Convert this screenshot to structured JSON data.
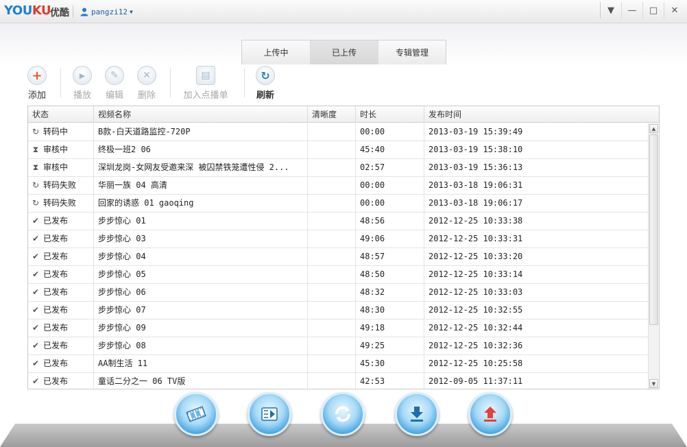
{
  "titlebar": {
    "logo_you": "YOU",
    "logo_ku": "KU",
    "logo_cn": "优酷",
    "username": "pangzi12",
    "caret": "▼",
    "win_buttons": [
      "▼",
      "—",
      "□",
      "✕"
    ]
  },
  "tabs": [
    {
      "label": "上传中",
      "active": false
    },
    {
      "label": "已上传",
      "active": true
    },
    {
      "label": "专辑管理",
      "active": false
    }
  ],
  "toolbar": {
    "add": {
      "label": "添加",
      "icon": "plus-icon",
      "glyph": "+",
      "color": "#e8572d"
    },
    "play": {
      "label": "播放",
      "icon": "play-icon",
      "glyph": "▶"
    },
    "edit": {
      "label": "编辑",
      "icon": "pencil-icon",
      "glyph": "✎"
    },
    "delete": {
      "label": "删除",
      "icon": "cross-icon",
      "glyph": "✕"
    },
    "add_playlist": {
      "label": "加入点播单",
      "icon": "document-icon",
      "glyph": "▤"
    },
    "refresh": {
      "label": "刷新",
      "icon": "refresh-icon",
      "glyph": "↻",
      "color": "#1c7fcf"
    }
  },
  "table": {
    "headers": [
      "状态",
      "视频名称",
      "清晰度",
      "时长",
      "发布时间"
    ],
    "rows": [
      {
        "status": "转码中",
        "icon": "↻",
        "name": "B款-白天道路监控-720P",
        "quality": "",
        "duration": "00:00",
        "time": "2013-03-19 15:39:49"
      },
      {
        "status": "审核中",
        "icon": "⧗",
        "name": "终极一班2 06",
        "quality": "",
        "duration": "45:40",
        "time": "2013-03-19 15:38:10"
      },
      {
        "status": "审核中",
        "icon": "⧗",
        "name": "深圳龙岗-女网友受邀来深 被囚禁铁笼遭性侵 2...",
        "quality": "",
        "duration": "02:57",
        "time": "2013-03-19 15:36:13"
      },
      {
        "status": "转码失败",
        "icon": "↻",
        "name": "华丽一族 04 高清",
        "quality": "",
        "duration": "00:00",
        "time": "2013-03-18 19:06:31"
      },
      {
        "status": "转码失败",
        "icon": "↻",
        "name": "回家的诱惑 01 gaoqing",
        "quality": "",
        "duration": "00:00",
        "time": "2013-03-18 19:06:17"
      },
      {
        "status": "已发布",
        "icon": "✔",
        "name": "步步惊心 01",
        "quality": "",
        "duration": "48:56",
        "time": "2012-12-25 10:33:38"
      },
      {
        "status": "已发布",
        "icon": "✔",
        "name": "步步惊心 03",
        "quality": "",
        "duration": "49:06",
        "time": "2012-12-25 10:33:31"
      },
      {
        "status": "已发布",
        "icon": "✔",
        "name": "步步惊心 04",
        "quality": "",
        "duration": "48:57",
        "time": "2012-12-25 10:33:20"
      },
      {
        "status": "已发布",
        "icon": "✔",
        "name": "步步惊心 05",
        "quality": "",
        "duration": "48:50",
        "time": "2012-12-25 10:33:14"
      },
      {
        "status": "已发布",
        "icon": "✔",
        "name": "步步惊心 06",
        "quality": "",
        "duration": "48:32",
        "time": "2012-12-25 10:33:03"
      },
      {
        "status": "已发布",
        "icon": "✔",
        "name": "步步惊心 07",
        "quality": "",
        "duration": "48:30",
        "time": "2012-12-25 10:32:55"
      },
      {
        "status": "已发布",
        "icon": "✔",
        "name": "步步惊心 09",
        "quality": "",
        "duration": "49:18",
        "time": "2012-12-25 10:32:44"
      },
      {
        "status": "已发布",
        "icon": "✔",
        "name": "步步惊心 08",
        "quality": "",
        "duration": "49:25",
        "time": "2012-12-25 10:32:36"
      },
      {
        "status": "已发布",
        "icon": "✔",
        "name": "AA制生活 11",
        "quality": "",
        "duration": "45:30",
        "time": "2012-12-25 10:25:58"
      },
      {
        "status": "已发布",
        "icon": "✔",
        "name": "童话二分之一 06 TV版",
        "quality": "",
        "duration": "42:53",
        "time": "2012-09-05 11:37:11"
      }
    ]
  },
  "scrollbar": {
    "up": "▲",
    "down": "▼"
  },
  "dock": [
    {
      "name": "film-strip-icon"
    },
    {
      "name": "video-list-icon"
    },
    {
      "name": "sync-icon"
    },
    {
      "name": "download-icon"
    },
    {
      "name": "upload-icon",
      "color": "#e0433a"
    }
  ]
}
